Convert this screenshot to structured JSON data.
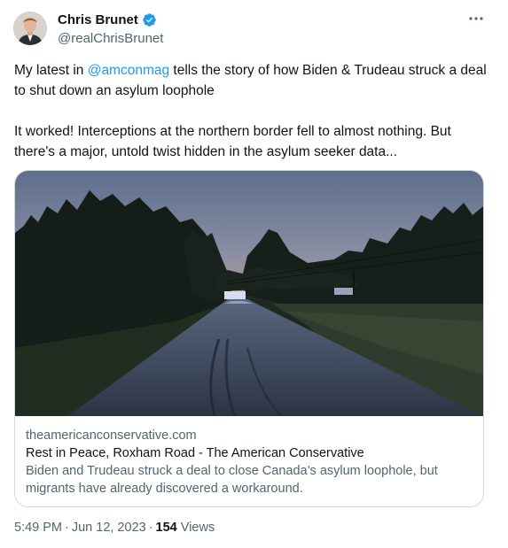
{
  "author": {
    "name": "Chris Brunet",
    "handle": "@realChrisBrunet",
    "verified_icon": "verified-badge-icon",
    "verified_color": "#1d9bf0"
  },
  "menu": {
    "icon": "more-horizontal-icon"
  },
  "tweet": {
    "p1_before": "My latest in ",
    "mention": "@amconmag",
    "p1_after": " tells the story of how Biden & Trudeau struck a deal to shut down an asylum loophole",
    "p2": "It worked! Interceptions at the northern border fell to almost nothing. But there's a major, untold twist hidden in the asylum seeker data..."
  },
  "card": {
    "domain": "theamericanconservative.com",
    "title": "Rest in Peace, Roxham Road - The American Conservative",
    "description": "Biden and Trudeau struck a deal to close Canada’s asylum loophole, but migrants have already discovered a workaround."
  },
  "meta": {
    "time": "5:49 PM",
    "separator": "·",
    "date": "Jun 12, 2023",
    "views_count": "154",
    "views_label": "Views"
  },
  "colors": {
    "accent": "#1d9bf0",
    "text": "#0f1419",
    "secondary": "#536471",
    "border": "#cfd9de"
  }
}
